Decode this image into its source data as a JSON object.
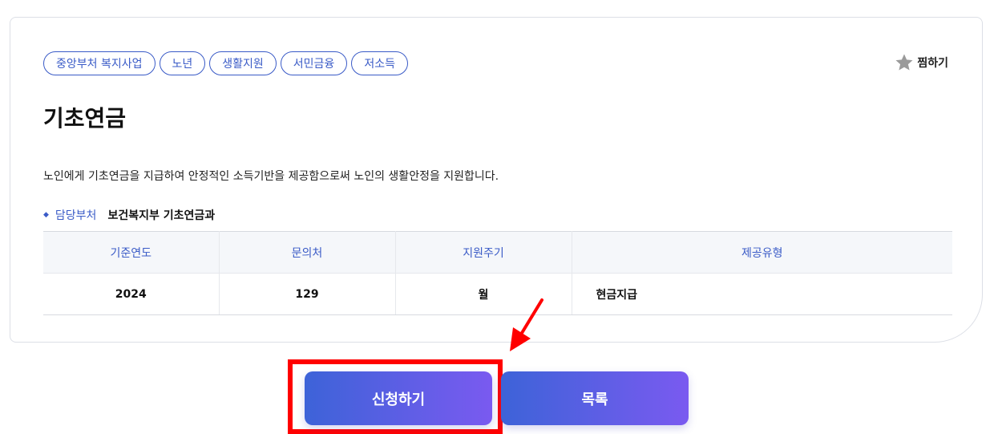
{
  "tags": [
    "중앙부처 복지사업",
    "노년",
    "생활지원",
    "서민금융",
    "저소득"
  ],
  "favorite_label": "찜하기",
  "title": "기초연금",
  "description": "노인에게 기초연금을 지급하여 안정적인 소득기반을 제공함으로써 노인의 생활안정을 지원합니다.",
  "department": {
    "label": "담당부처",
    "value": "보건복지부 기초연금과"
  },
  "table": {
    "headers": [
      "기준연도",
      "문의처",
      "지원주기",
      "제공유형"
    ],
    "row": [
      "2024",
      "129",
      "월",
      "현금지급"
    ]
  },
  "buttons": {
    "apply": "신청하기",
    "list": "목록"
  },
  "colors": {
    "accent": "#3a5bc7",
    "highlight": "#ff0000",
    "button_gradient_start": "#3d63d8",
    "button_gradient_end": "#7a5af0"
  }
}
